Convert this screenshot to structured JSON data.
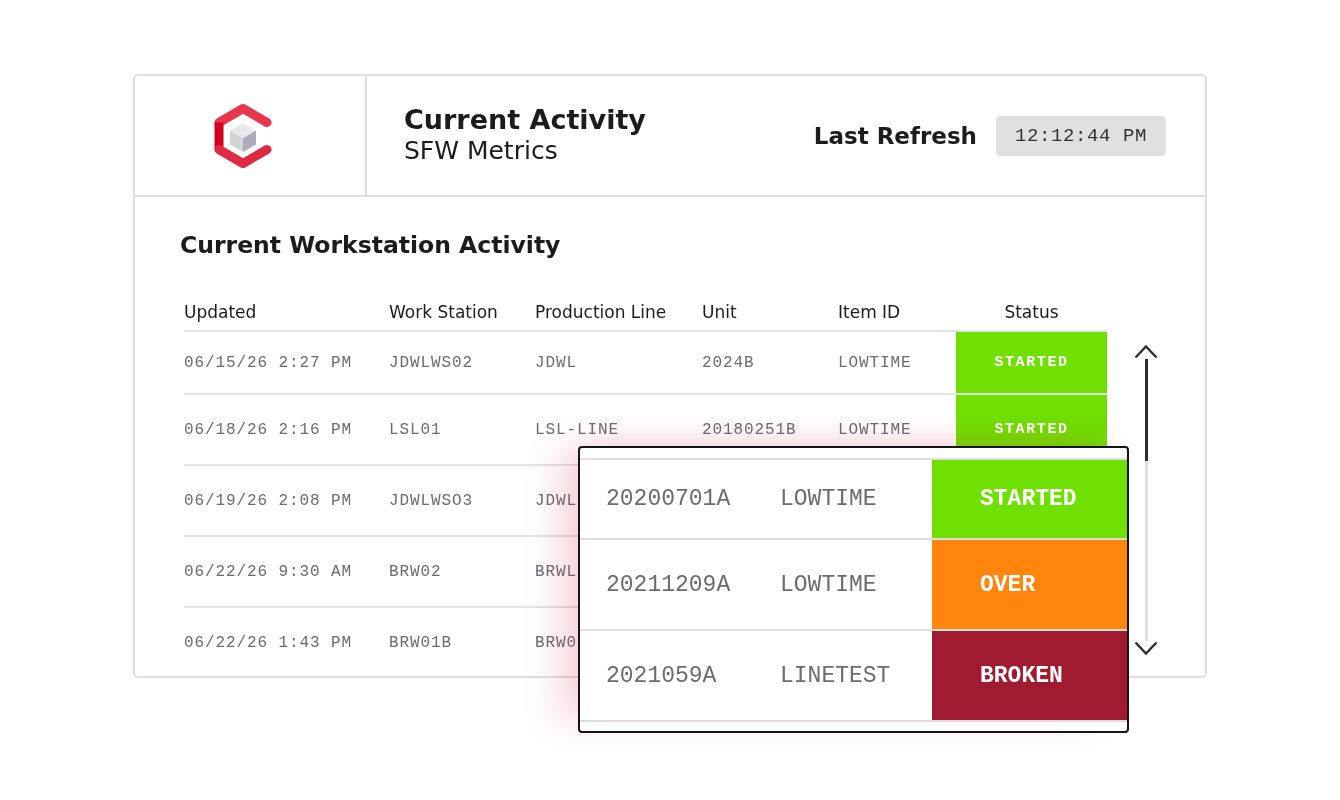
{
  "header": {
    "title": "Current Activity",
    "subtitle": "SFW Metrics",
    "refresh_label": "Last Refresh",
    "refresh_time": "12:12:44 PM"
  },
  "section_title": "Current Workstation Activity",
  "table": {
    "columns": [
      "Updated",
      "Work Station",
      "Production Line",
      "Unit",
      "Item ID",
      "Status"
    ],
    "rows": [
      {
        "updated": "06/15/26 2:27 PM",
        "work_station": "JDWLWS02",
        "production_line": "JDWL",
        "unit": "2024B",
        "item_id": "LOWTIME",
        "status": "STARTED",
        "color": "#6fe000"
      },
      {
        "updated": "06/18/26 2:16 PM",
        "work_station": "LSL01",
        "production_line": "LSL-LINE",
        "unit": "20180251B",
        "item_id": "LOWTIME",
        "status": "STARTED",
        "color": "#6fe000"
      },
      {
        "updated": "06/19/26 2:08 PM",
        "work_station": "JDWLWSO3",
        "production_line": "JDWL"
      },
      {
        "updated": "06/22/26 9:30 AM",
        "work_station": "BRW02",
        "production_line": "BRWL"
      },
      {
        "updated": "06/22/26 1:43 PM",
        "work_station": "BRW01B",
        "production_line": "BRW0"
      }
    ]
  },
  "detail_popup": {
    "rows": [
      {
        "unit": "20200701A",
        "item_id": "LOWTIME",
        "status": "STARTED",
        "color": "#6fe000"
      },
      {
        "unit": "20211209A",
        "item_id": "LOWTIME",
        "status": "OVER",
        "color": "#ff850d"
      },
      {
        "unit": "2021059A",
        "item_id": "LINETEST",
        "status": "BROKEN",
        "color": "#a01b2f"
      }
    ]
  }
}
